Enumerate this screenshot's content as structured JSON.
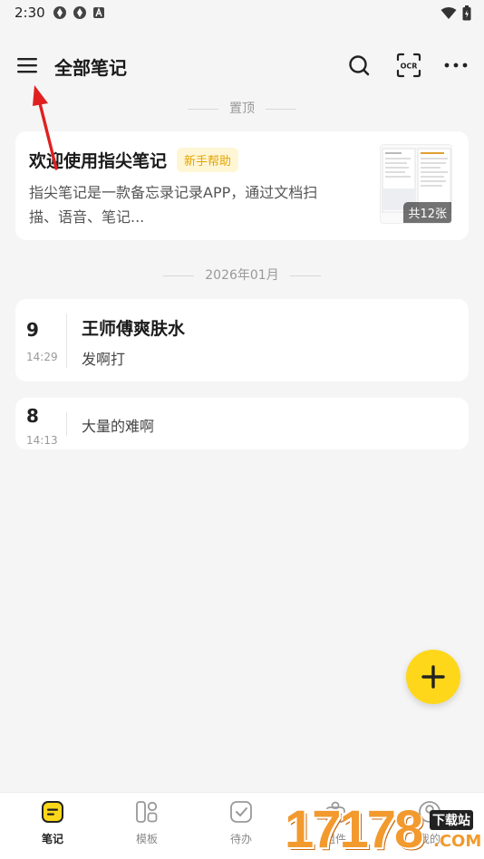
{
  "status": {
    "time": "2:30"
  },
  "header": {
    "title": "全部笔记"
  },
  "sections": {
    "pinned": "置顶",
    "month": "2026年01月"
  },
  "pinned_note": {
    "title": "欢迎使用指尖笔记",
    "badge": "新手帮助",
    "desc_line1": "指尖笔记是一款备忘录记录APP，通过文档扫",
    "desc_line2": "描、语音、笔记...",
    "image_count": "共12张"
  },
  "notes": [
    {
      "day": "9",
      "time": "14:29",
      "title": "王师傅爽肤水",
      "body": "发啊打"
    },
    {
      "day": "8",
      "time": "14:13",
      "title": "",
      "body": "大量的难啊"
    }
  ],
  "nav": [
    {
      "label": "笔记",
      "active": true
    },
    {
      "label": "模板",
      "active": false
    },
    {
      "label": "待办",
      "active": false
    },
    {
      "label": "组件",
      "active": false
    },
    {
      "label": "我的",
      "active": false
    }
  ],
  "watermark": {
    "digits": "17178",
    "sub": "下载站",
    "com": ".COM"
  },
  "colors": {
    "accent": "#ffd71a",
    "badge_text": "#e5a400",
    "annotation_arrow": "#e02020"
  }
}
